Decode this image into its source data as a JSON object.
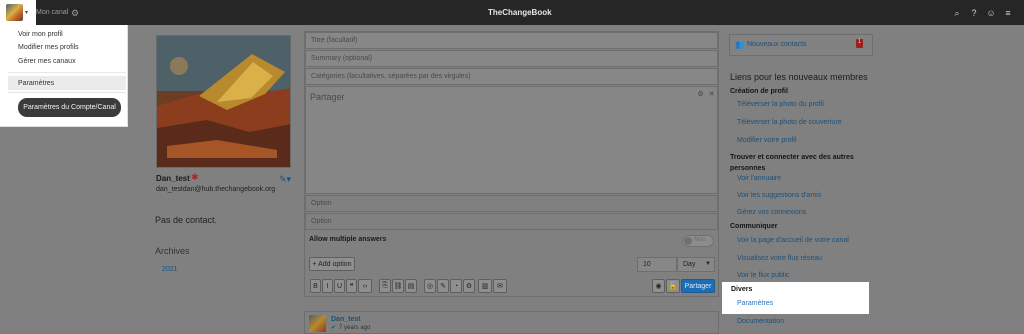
{
  "header": {
    "channel_label": "Mon canal",
    "app_title": "TheChangeBook"
  },
  "dropdown": {
    "items": [
      "Voir mon profil",
      "Modifier mes profils",
      "Gérer mes canaux"
    ],
    "settings_label": "Paramètres",
    "account_settings_label": "Paramètres du Compte/Canal"
  },
  "profile": {
    "name": "Dan_test",
    "address": "dan_testdan@hub.thechangebook.org",
    "no_contacts": "Pas de contact.",
    "archives_title": "Archives",
    "archive_year": "2021"
  },
  "composer": {
    "title_placeholder": "Titre (facultatif)",
    "summary_placeholder": "Summary (optional)",
    "categories_placeholder": "Catégories (facultatives, séparées par des virgules)",
    "body_placeholder": "Partager",
    "option1": "Option",
    "option2": "Option",
    "allow_multiple": "Allow multiple answers",
    "toggle_label": "Non",
    "add_option": "+ Add option",
    "duration_value": "10",
    "duration_unit": "Day",
    "share_button": "Partager"
  },
  "post": {
    "author": "Dan_test",
    "time": "7 years ago"
  },
  "right": {
    "new_contacts": "Nouveaux contacts",
    "new_contacts_badge": "1",
    "links_title": "Liens pour les nouveaux membres",
    "profile_section": "Création de profil",
    "profile_links": [
      "Téléverser la photo du profil",
      "Téléverser la photo de couverture",
      "Modifier votre profil"
    ],
    "connect_section": "Trouver et connecter avec des autres personnes",
    "connect_links": [
      "Voir l'annuaire",
      "Voir les suggestions d'amis",
      "Gérez vos connexions"
    ],
    "communicate_section": "Communiquer",
    "communicate_links": [
      "Voir la page d'accueil de votre canal",
      "Visualisez votre flux réseau",
      "Voir le flux public"
    ],
    "misc_section": "Divers",
    "misc_links": [
      "Paramètres",
      "Documentation"
    ]
  },
  "colors": {
    "topbar": "#262626",
    "overlay_bg": "#808080",
    "link": "#1d4f7a",
    "share_button": "#1f6db5",
    "account_button": "#3b3b3b"
  }
}
